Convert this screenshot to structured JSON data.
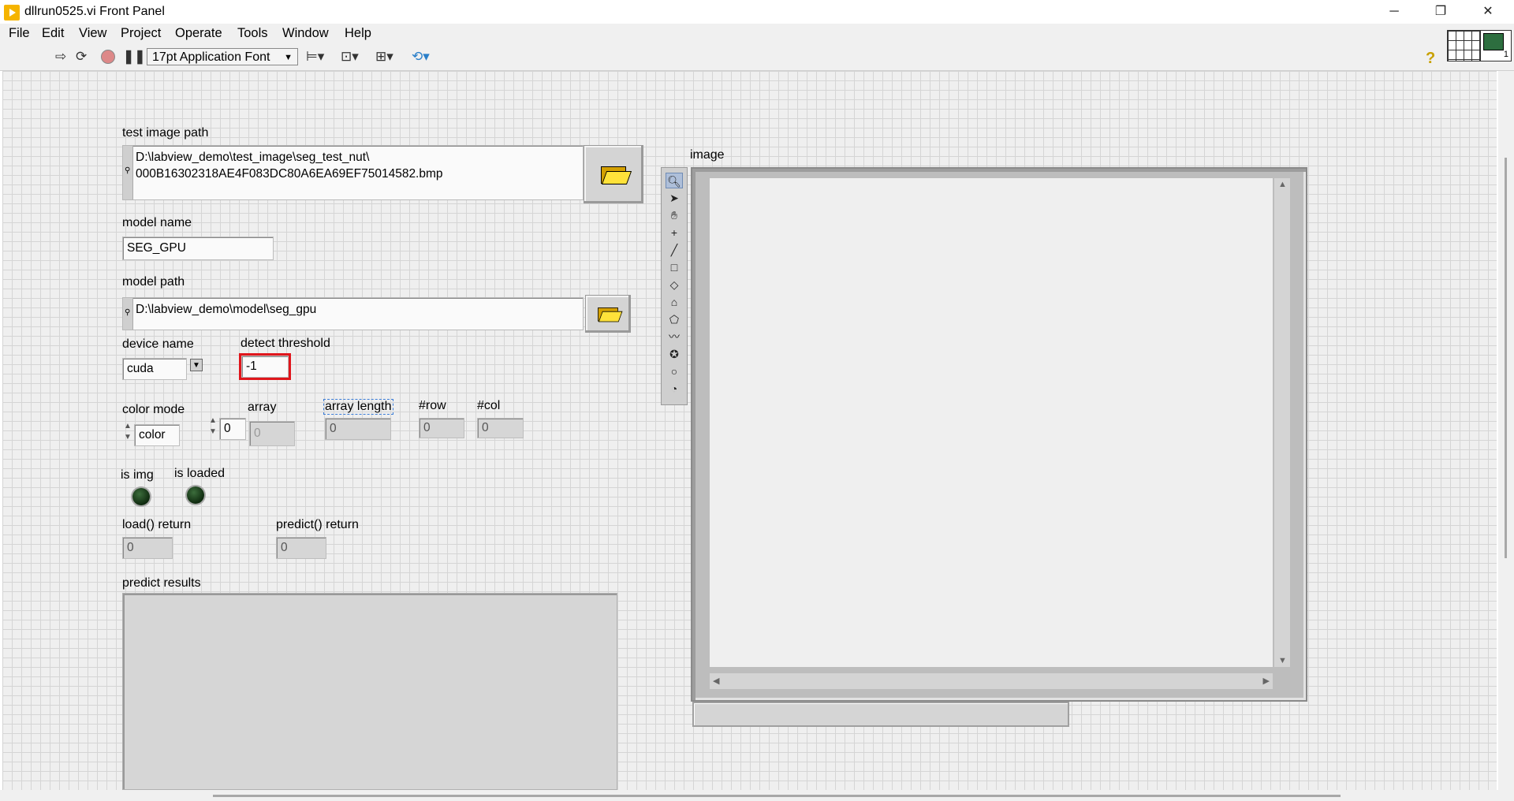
{
  "window": {
    "title": "dllrun0525.vi Front Panel",
    "buttons": {
      "minimize": "─",
      "restore": "❐",
      "close": "✕"
    }
  },
  "menu": [
    "File",
    "Edit",
    "View",
    "Project",
    "Operate",
    "Tools",
    "Window",
    "Help"
  ],
  "toolbar": {
    "font": "17pt Application Font",
    "help": "?"
  },
  "connector_pane": {
    "terminal_count": "1"
  },
  "controls": {
    "test_image_path": {
      "label": "test image path",
      "line1": "D:\\labview_demo\\test_image\\seg_test_nut\\",
      "line2": "000B16302318AE4F083DC80A6EA69EF75014582.bmp"
    },
    "model_name": {
      "label": "model name",
      "value": "SEG_GPU"
    },
    "model_path": {
      "label": "model path",
      "value": "D:\\labview_demo\\model\\seg_gpu"
    },
    "device_name": {
      "label": "device name",
      "value": "cuda"
    },
    "detect_threshold": {
      "label": "detect threshold",
      "value": "-1"
    },
    "color_mode": {
      "label": "color mode",
      "value": "color"
    },
    "array": {
      "label": "array",
      "index": "0",
      "value": "0"
    },
    "array_length": {
      "label": "array length",
      "value": "0"
    },
    "row": {
      "label": "#row",
      "value": "0"
    },
    "col": {
      "label": "#col",
      "value": "0"
    },
    "is_img": {
      "label": "is img"
    },
    "is_loaded": {
      "label": "is loaded"
    },
    "load_return": {
      "label": "load() return",
      "value": "0"
    },
    "predict_return": {
      "label": "predict() return",
      "value": "0"
    },
    "predict_results": {
      "label": "predict results"
    },
    "image": {
      "label": "image"
    }
  },
  "image_tools": [
    "zoom-icon",
    "pointer-icon",
    "pan-icon",
    "point-icon",
    "line-icon",
    "rectangle-icon",
    "rotated-rectangle-icon",
    "annulus-icon",
    "polygon-icon",
    "freehand-icon",
    "broken-line-icon",
    "oval-icon",
    "annulus-arc-icon"
  ]
}
